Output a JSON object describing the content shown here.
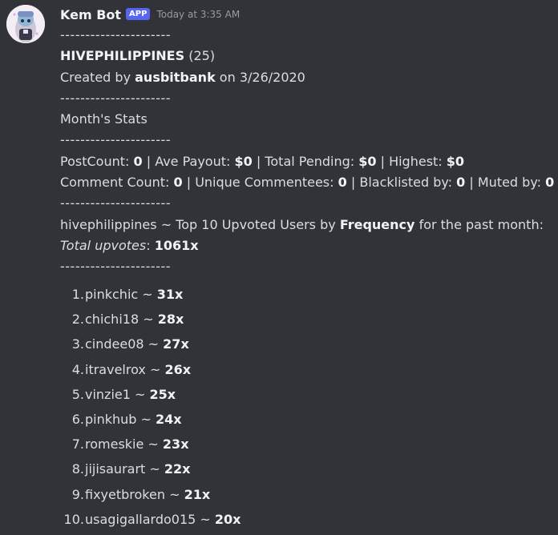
{
  "author": {
    "name": "Kem Bot",
    "badge": "APP",
    "timestamp": "Today at 3:35 AM",
    "avatar": "kem-bot-avatar"
  },
  "message": {
    "separator": "----------------------",
    "community": "HIVEPHILIPPINES",
    "community_count": "(25)",
    "created_prefix": "Created by",
    "created_user": "ausbitbank",
    "created_mid": "on 3/26/2020",
    "month_stats": "Month's Stats",
    "stats1": {
      "post_count_label": "PostCount:",
      "post_count": "0",
      "ave_payout_label": "| Ave Payout:",
      "ave_payout": "$0",
      "total_pending_label": "| Total Pending:",
      "total_pending": "$0",
      "highest_label": "| Highest:",
      "highest": "$0"
    },
    "stats2": {
      "comment_count_label": "Comment Count:",
      "comment_count": "0",
      "unique_label": "| Unique Commentees:",
      "unique": "0",
      "blacklisted_label": "| Blacklisted by:",
      "blacklisted": "0",
      "muted_label": "| Muted by:",
      "muted": "0"
    },
    "top_prefix": "hivephilippines ~ Top 10 Upvoted Users by",
    "top_bold": "Frequency",
    "top_suffix": "for the past month:",
    "total_upvotes_label": "Total upvotes",
    "total_upvotes_colon": ":",
    "total_upvotes": "1061x"
  },
  "top_users": [
    {
      "rank": "1.",
      "user": "pinkchic ~",
      "count": "31x"
    },
    {
      "rank": "2.",
      "user": "chichi18 ~",
      "count": "28x"
    },
    {
      "rank": "3.",
      "user": "cindee08 ~",
      "count": "27x"
    },
    {
      "rank": "4.",
      "user": "itravelrox ~",
      "count": "26x"
    },
    {
      "rank": "5.",
      "user": "vinzie1 ~",
      "count": "25x"
    },
    {
      "rank": "6.",
      "user": "pinkhub ~",
      "count": "24x"
    },
    {
      "rank": "7.",
      "user": "romeskie ~",
      "count": "23x"
    },
    {
      "rank": "8.",
      "user": "jijisaurart ~",
      "count": "22x"
    },
    {
      "rank": "9.",
      "user": "fixyetbroken ~",
      "count": "21x"
    },
    {
      "rank": "10.",
      "user": "usagigallardo015 ~",
      "count": "20x"
    }
  ]
}
